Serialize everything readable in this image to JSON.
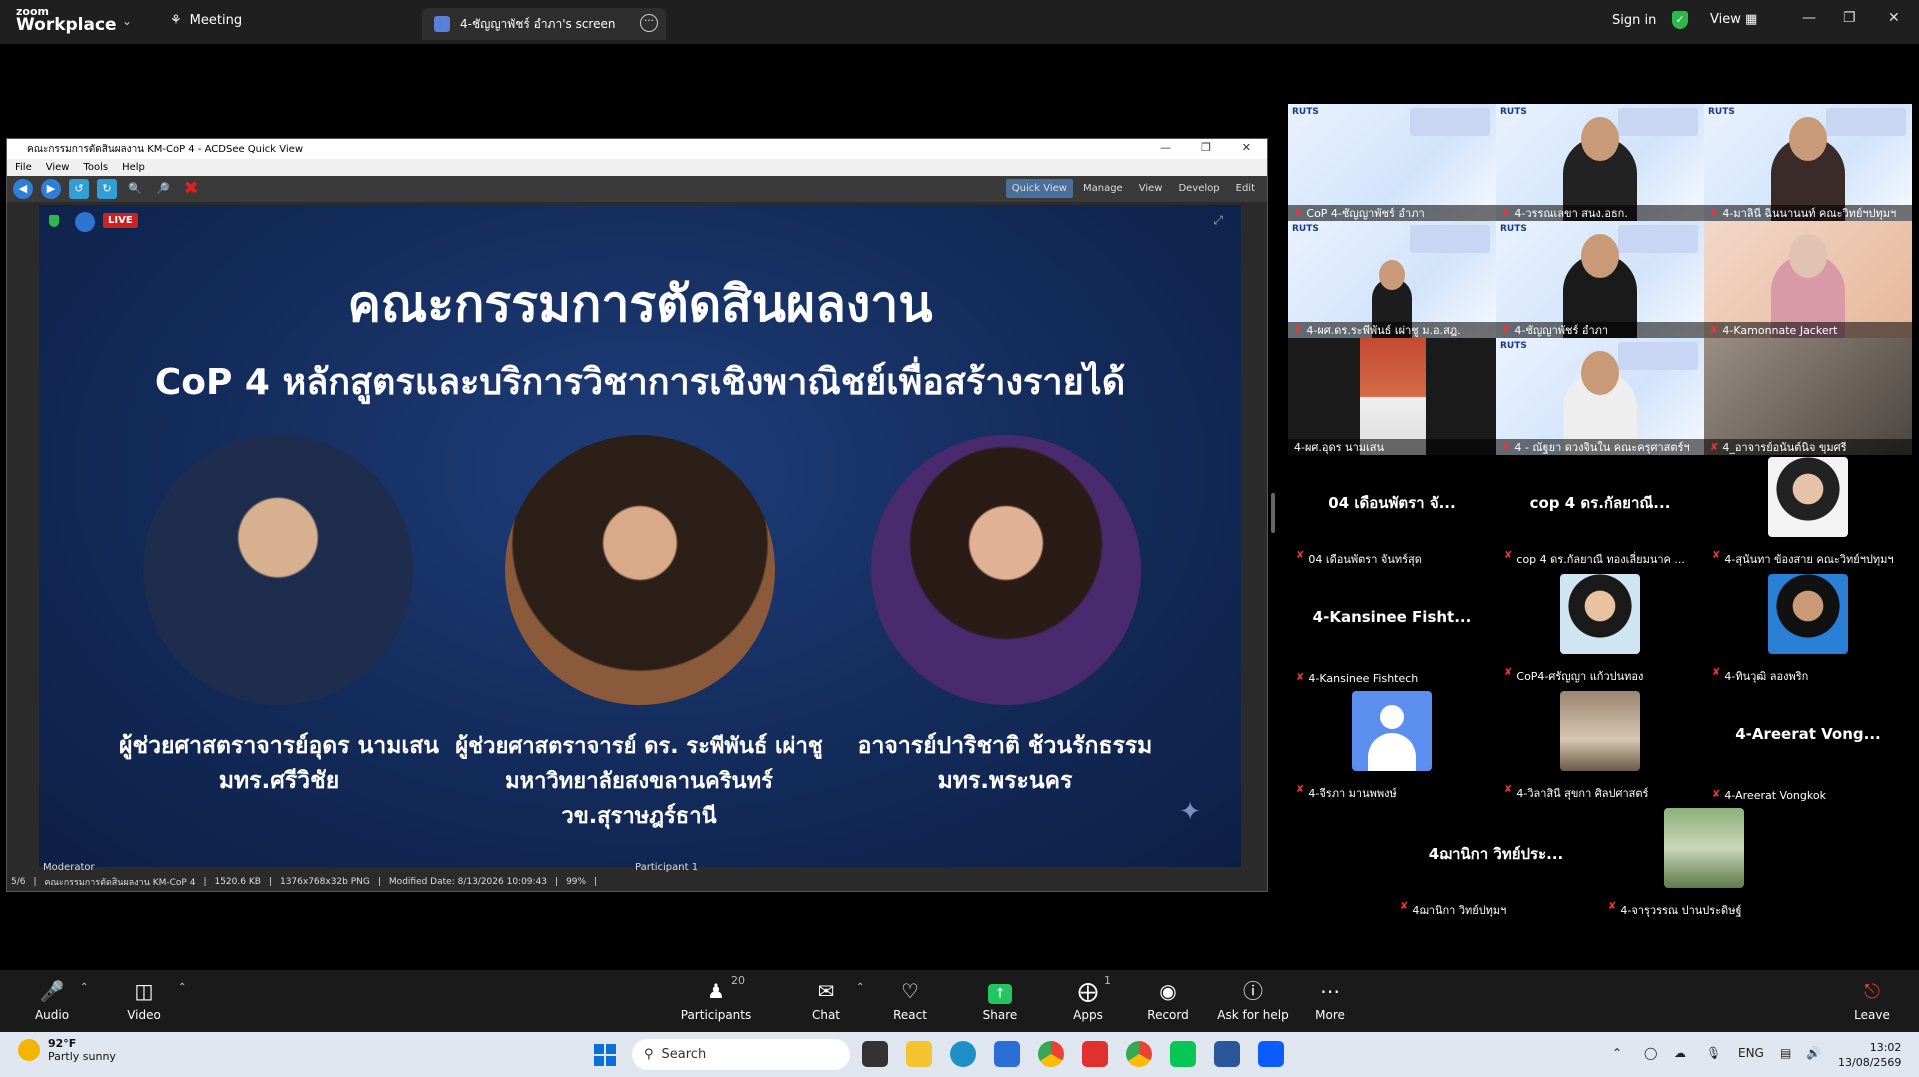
{
  "app": {
    "logo_top": "zoom",
    "logo_bottom": "Workplace",
    "meeting_tab": "Meeting",
    "screen_tab": "4-ชัญญาพัชร์ อำภา's screen",
    "sign_in": "Sign in",
    "view": "View"
  },
  "acdsee": {
    "title": "คณะกรรมการตัดสินผลงาน KM-CoP 4 - ACDSee Quick View",
    "menu": [
      "File",
      "View",
      "Tools",
      "Help"
    ],
    "modes": [
      "Quick View",
      "Manage",
      "View",
      "Develop",
      "Edit"
    ],
    "status": [
      "5/6",
      "คณะกรรมการตัดสินผลงาน KM-CoP 4",
      "1520.6 KB",
      "1376x768x32b PNG",
      "Modified Date: 8/13/2026 10:09:43",
      "99%"
    ]
  },
  "slide": {
    "live": "LIVE",
    "title": "คณะกรรมการตัดสินผลงาน",
    "subtitle": "CoP 4 หลักสูตรและบริการวิชาการเชิงพาณิชย์เพื่อสร้างรายได้",
    "judges": [
      {
        "name": "ผู้ช่วยศาสตราจารย์อุดร นามเสน",
        "org": "มทร.ศรีวิชัย"
      },
      {
        "name": "ผู้ช่วยศาสตราจารย์ ดร. ระพีพันธ์ เผ่าชู",
        "org": "มหาวิทยาลัยสงขลานครินทร์ วข.สุราษฎร์ธานี"
      },
      {
        "name": "อาจารย์ปาริชาติ ช้วนรักธรรม",
        "org": "มทร.พระนคร"
      }
    ],
    "moderator": "Moderator",
    "participant": "Participant 1"
  },
  "video_tiles": [
    "CoP 4-ชัญญาพัชร์ อำภา",
    "4-วรรณเลขา สนง.อธก.",
    "4-มาลินี ฉินนานนท์ คณะวิทย์ฯปทุมฯ",
    "4-ผศ.ดร.ระพีพันธ์ เผ่าชู ม.อ.สฎ.",
    "4-ชัญญาพัชร์ อำภา",
    "4-Kamonnate Jackert",
    "4-ผศ.อุดร นามเสน",
    "4 - ณัฐยา ดวงจินใน คณะครุศาสตร์ฯ",
    "4_อาจารย์อนันต์นิจ ขุมศรี"
  ],
  "participant_tiles": [
    {
      "big": "04 เดือนพัตรา จั...",
      "small": "04 เดือนพัตรา จันทร์สุด"
    },
    {
      "big": "cop 4 ดร.กัลยาณี...",
      "small": "cop 4 ดร.กัลยาณี ทองเลี่ยมนาค ..."
    },
    {
      "big": "",
      "small": "4-สุนันทา ข้องสาย คณะวิทย์ฯปทุมฯ"
    },
    {
      "big": "4-Kansinee Fisht...",
      "small": "4-Kansinee Fishtech"
    },
    {
      "big": "",
      "small": "CoP4-ศรัญญา แก้วปนทอง"
    },
    {
      "big": "",
      "small": "4-ทินวุฒิ ลองพริก"
    },
    {
      "big": "",
      "small": "4-จีรภา มานพพงษ์"
    },
    {
      "big": "",
      "small": "4-วิลาสินี สุขกา ศิลปศาสตร์"
    },
    {
      "big": "4-Areerat Vong...",
      "small": "4-Areerat Vongkok"
    },
    {
      "big": "4ฌานิกา วิทย์ประ...",
      "small": "4ฌานิกา วิทย์ปทุมฯ"
    },
    {
      "big": "",
      "small": "4-จารุวรรณ ปานประดิษฐ์"
    }
  ],
  "toolbar": {
    "audio": "Audio",
    "video": "Video",
    "participants": "Participants",
    "participants_count": "20",
    "chat": "Chat",
    "react": "React",
    "share": "Share",
    "apps": "Apps",
    "apps_count": "1",
    "record": "Record",
    "help": "Ask for help",
    "more": "More",
    "leave": "Leave"
  },
  "taskbar": {
    "temp": "92°F",
    "weather": "Partly sunny",
    "search": "Search",
    "lang": "ENG",
    "time": "13:02",
    "date": "13/08/2569"
  }
}
